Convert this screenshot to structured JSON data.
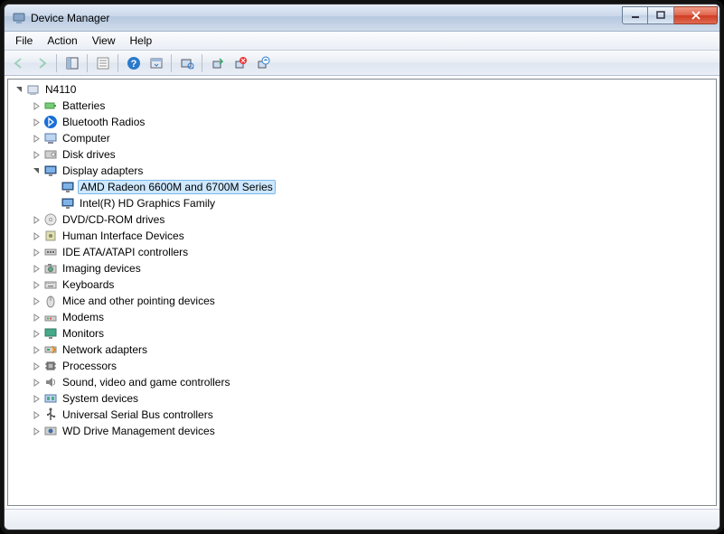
{
  "window": {
    "title": "Device Manager"
  },
  "menu": {
    "file": "File",
    "action": "Action",
    "view": "View",
    "help": "Help"
  },
  "tree": {
    "root": "N4110",
    "items": [
      {
        "label": "Batteries",
        "icon": "battery"
      },
      {
        "label": "Bluetooth Radios",
        "icon": "bluetooth"
      },
      {
        "label": "Computer",
        "icon": "computer"
      },
      {
        "label": "Disk drives",
        "icon": "disk"
      },
      {
        "label": "Display adapters",
        "icon": "display",
        "expanded": true,
        "children": [
          {
            "label": "AMD Radeon 6600M and 6700M Series",
            "icon": "display",
            "selected": true
          },
          {
            "label": "Intel(R) HD Graphics Family",
            "icon": "display"
          }
        ]
      },
      {
        "label": "DVD/CD-ROM drives",
        "icon": "dvd"
      },
      {
        "label": "Human Interface Devices",
        "icon": "hid"
      },
      {
        "label": "IDE ATA/ATAPI controllers",
        "icon": "ide"
      },
      {
        "label": "Imaging devices",
        "icon": "imaging"
      },
      {
        "label": "Keyboards",
        "icon": "keyboard"
      },
      {
        "label": "Mice and other pointing devices",
        "icon": "mouse"
      },
      {
        "label": "Modems",
        "icon": "modem"
      },
      {
        "label": "Monitors",
        "icon": "monitor"
      },
      {
        "label": "Network adapters",
        "icon": "network"
      },
      {
        "label": "Processors",
        "icon": "cpu"
      },
      {
        "label": "Sound, video and game controllers",
        "icon": "sound"
      },
      {
        "label": "System devices",
        "icon": "system"
      },
      {
        "label": "Universal Serial Bus controllers",
        "icon": "usb"
      },
      {
        "label": "WD Drive Management devices",
        "icon": "wd"
      }
    ]
  }
}
